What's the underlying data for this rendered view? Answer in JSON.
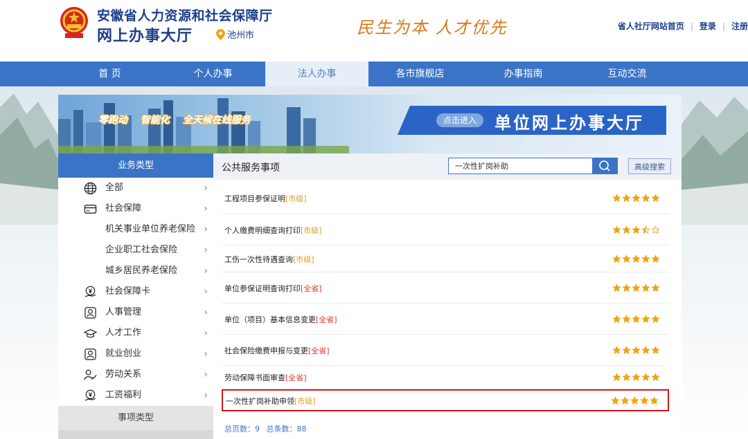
{
  "header": {
    "site_title": "安徽省人力资源和社会保障厅",
    "hall_title": "网上办事大厅",
    "city": "池州市",
    "slogan": "民生为本 人才优先",
    "links": [
      "省人社厅网站首页",
      "登录",
      "注册"
    ]
  },
  "nav": {
    "items": [
      {
        "label": "首 页"
      },
      {
        "label": "个人办事"
      },
      {
        "label": "法人办事",
        "active": true
      },
      {
        "label": "各市旗舰店"
      },
      {
        "label": "办事指南"
      },
      {
        "label": "互动交流"
      }
    ]
  },
  "banner": {
    "tags": [
      "零跑动",
      "智能化",
      "全天候在线服务"
    ],
    "enter_label": "点击进入",
    "cta_title": "单位网上办事大厅"
  },
  "sidebar": {
    "header": "业务类型",
    "items": [
      {
        "label": "全部",
        "icon": "globe-icon"
      },
      {
        "label": "社会保障",
        "icon": "card-icon"
      },
      {
        "label": "机关事业单位养老保险",
        "icon": ""
      },
      {
        "label": "企业职工社会保险",
        "icon": ""
      },
      {
        "label": "城乡居民养老保险",
        "icon": ""
      },
      {
        "label": "社会保障卡",
        "icon": "hand-yuan-icon"
      },
      {
        "label": "人事管理",
        "icon": "person-badge-icon"
      },
      {
        "label": "人才工作",
        "icon": "graduation-cap-icon"
      },
      {
        "label": "就业创业",
        "icon": "person-badge-icon"
      },
      {
        "label": "劳动关系",
        "icon": "people-check-icon"
      },
      {
        "label": "工资福利",
        "icon": "hand-yuan-icon"
      }
    ],
    "footer": "事项类型"
  },
  "main": {
    "title": "公共服务事项",
    "search": {
      "value": "一次性扩岗补助",
      "placeholder": ""
    },
    "advanced_label": "高级搜索",
    "rows": [
      {
        "name": "工程项目参保证明",
        "tag": "[市级]",
        "tag_type": "city",
        "rating": 5
      },
      {
        "name": "个人缴费明细查询打印",
        "tag": "[市级]",
        "tag_type": "city",
        "rating": 3.5
      },
      {
        "name": "工伤一次性待遇查询",
        "tag": "[市级]",
        "tag_type": "city",
        "rating": 5
      },
      {
        "name": "单位参保证明查询打印",
        "tag": "[全省]",
        "tag_type": "prov",
        "rating": 5
      },
      {
        "name": "单位（项目）基本信息变更",
        "tag": "[全省]",
        "tag_type": "prov",
        "rating": 5
      },
      {
        "name": "社会保险缴费申报与变更",
        "tag": "[全省]",
        "tag_type": "prov",
        "rating": 5
      },
      {
        "name": "劳动保障书面审查",
        "tag": "[全省]",
        "tag_type": "prov",
        "rating": 5
      },
      {
        "name": "一次性扩岗补助申领",
        "tag": "[市级]",
        "tag_type": "city",
        "rating": 5,
        "highlighted": true
      }
    ],
    "totals": {
      "pages_label": "总页数：9",
      "count_label": "总条数：88"
    }
  },
  "colors": {
    "brand_blue": "#3b74c6",
    "title_blue": "#1c3f8c",
    "star": "#f0a313",
    "tag_city": "#e29a1c",
    "tag_prov": "#e0352b",
    "highlight": "#d4141c"
  }
}
